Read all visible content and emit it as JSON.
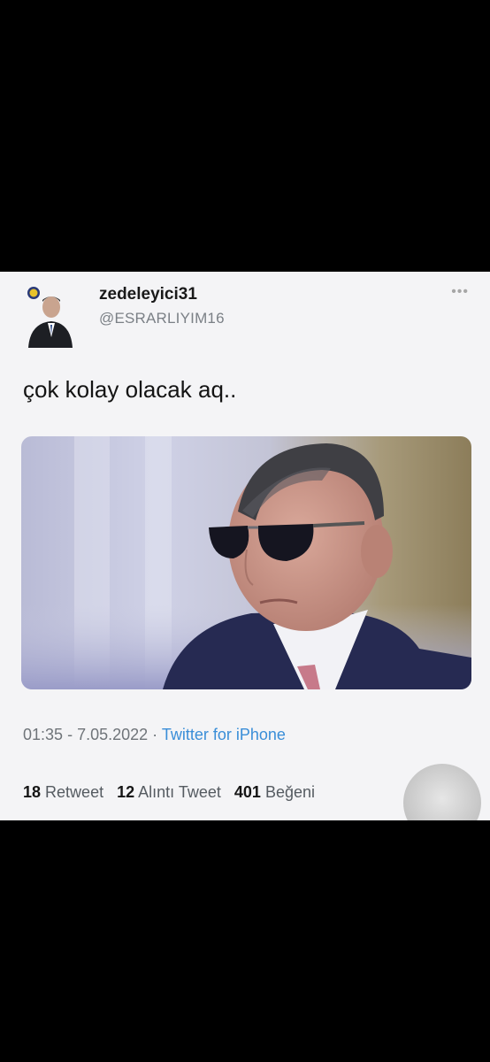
{
  "tweet": {
    "user": {
      "name": "zedeleyici31",
      "handle": "@ESRARLIYIM16"
    },
    "more_icon": "more-dots-icon",
    "text": "çok kolay olacak aq..",
    "time": "01:35",
    "date": "7.05.2022",
    "source": "Twitter for iPhone",
    "stats": {
      "retweets": {
        "count": "18",
        "label": "Retweet"
      },
      "quotes": {
        "count": "12",
        "label": "Alıntı Tweet"
      },
      "likes": {
        "count": "401",
        "label": "Beğeni"
      }
    }
  }
}
